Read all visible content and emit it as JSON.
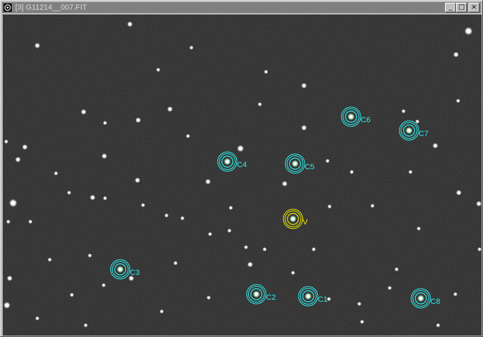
{
  "window": {
    "title": "[3] G11214__007.FIT",
    "buttons": {
      "minimize": "_",
      "maximize": "□",
      "close": "×"
    }
  },
  "colors": {
    "comparison_marker": "#2ff0f0",
    "variable_marker": "#f0f000",
    "sky_background": "#1f1f1f"
  },
  "markers": {
    "variable": {
      "label": "V"
    },
    "comparison": [
      {
        "label": "C1"
      },
      {
        "label": "C2"
      },
      {
        "label": "C3"
      },
      {
        "label": "C4"
      },
      {
        "label": "C5"
      },
      {
        "label": "C6"
      },
      {
        "label": "C7"
      },
      {
        "label": "C8"
      }
    ]
  }
}
